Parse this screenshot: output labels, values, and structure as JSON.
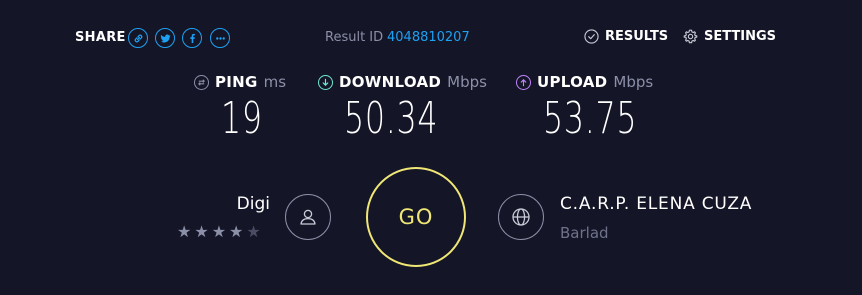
{
  "share": {
    "label": "SHARE",
    "icons": [
      "link-icon",
      "twitter-icon",
      "facebook-icon",
      "more-icon"
    ]
  },
  "result": {
    "label": "Result ID",
    "id": "4048810207"
  },
  "nav": {
    "results": "RESULTS",
    "settings": "SETTINGS"
  },
  "metrics": {
    "ping": {
      "name": "PING",
      "unit": "ms",
      "value": "19"
    },
    "download": {
      "name": "DOWNLOAD",
      "unit": "Mbps",
      "value": "50.34"
    },
    "upload": {
      "name": "UPLOAD",
      "unit": "Mbps",
      "value": "53.75"
    }
  },
  "isp": {
    "name": "Digi",
    "rating": 4,
    "rating_max": 5
  },
  "go": {
    "label": "GO"
  },
  "server": {
    "name": "C.A.R.P. ELENA CUZA",
    "location": "Barlad"
  },
  "colors": {
    "background": "#141526",
    "accent_blue": "#1da1f2",
    "go_yellow": "#efe676",
    "download_cyan": "#6ee7d4",
    "upload_purple": "#c084fc",
    "muted": "#8c8fa8"
  }
}
